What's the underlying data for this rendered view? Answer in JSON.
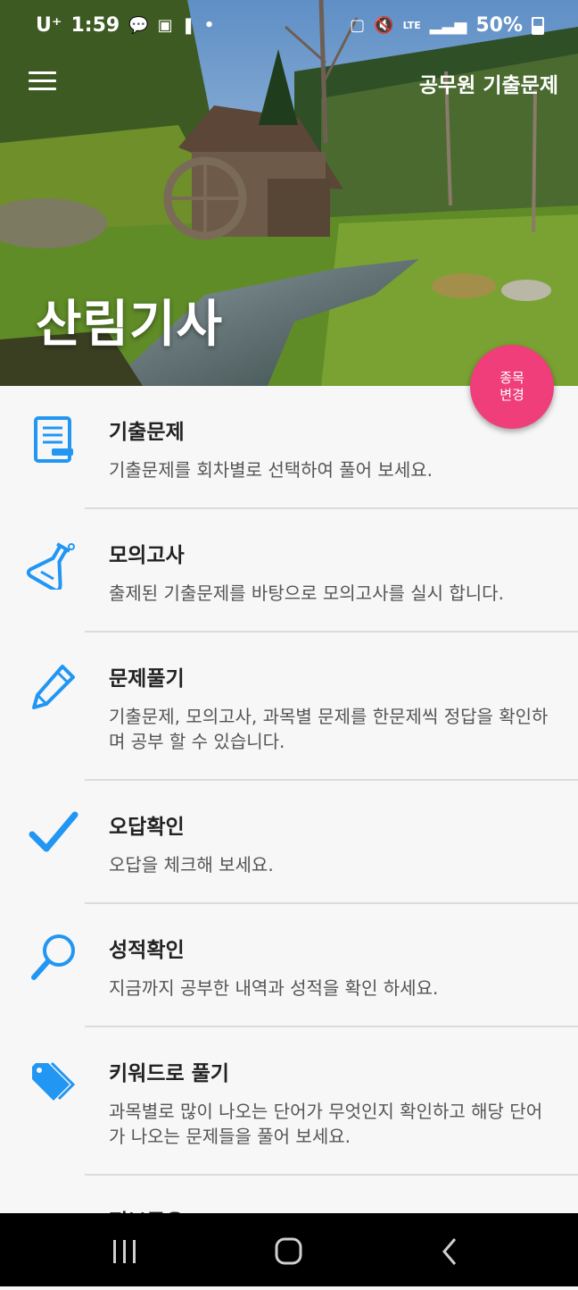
{
  "status_bar": {
    "carrier": "U⁺",
    "time": "1:59",
    "left_icons": [
      "talk-icon",
      "gallery-icon",
      "notification-icon",
      "dot-icon"
    ],
    "right_icons": [
      "battery-saver-icon",
      "mute-icon",
      "lte-icon",
      "signal-icon"
    ],
    "battery": "50%"
  },
  "app_bar": {
    "menu_icon": "hamburger-menu-icon",
    "title": "공무원 기출문제"
  },
  "hero": {
    "title": "산림기사"
  },
  "fab": {
    "line1": "종목",
    "line2": "변경",
    "color": "#ef3e79"
  },
  "accent_color": "#2196f3",
  "menu_items": [
    {
      "icon": "notebook-icon",
      "title": "기출문제",
      "desc": "기출문제를 회차별로 선택하여 풀어 보세요."
    },
    {
      "icon": "flask-icon",
      "title": "모의고사",
      "desc": "출제된 기출문제를 바탕으로 모의고사를 실시 합니다."
    },
    {
      "icon": "pencil-icon",
      "title": "문제풀기",
      "desc": "기출문제, 모의고사, 과목별 문제를 한문제씩 정답을 확인하며 공부 할 수 있습니다."
    },
    {
      "icon": "checkmark-icon",
      "title": "오답확인",
      "desc": "오답을 체크해 보세요."
    },
    {
      "icon": "magnifier-icon",
      "title": "성적확인",
      "desc": "지금까지 공부한 내역과 성적을 확인 하세요."
    },
    {
      "icon": "tag-icon",
      "title": "키워드로 풀기",
      "desc": "과목별로 많이 나오는 단어가 무엇인지 확인하고 해당 단어가 나오는 문제들을 풀어 보세요."
    },
    {
      "icon": "info-icon",
      "title": "정보공유",
      "desc": ""
    }
  ],
  "nav_bar": {
    "buttons": [
      "recent-apps-icon",
      "home-icon",
      "back-icon"
    ]
  }
}
